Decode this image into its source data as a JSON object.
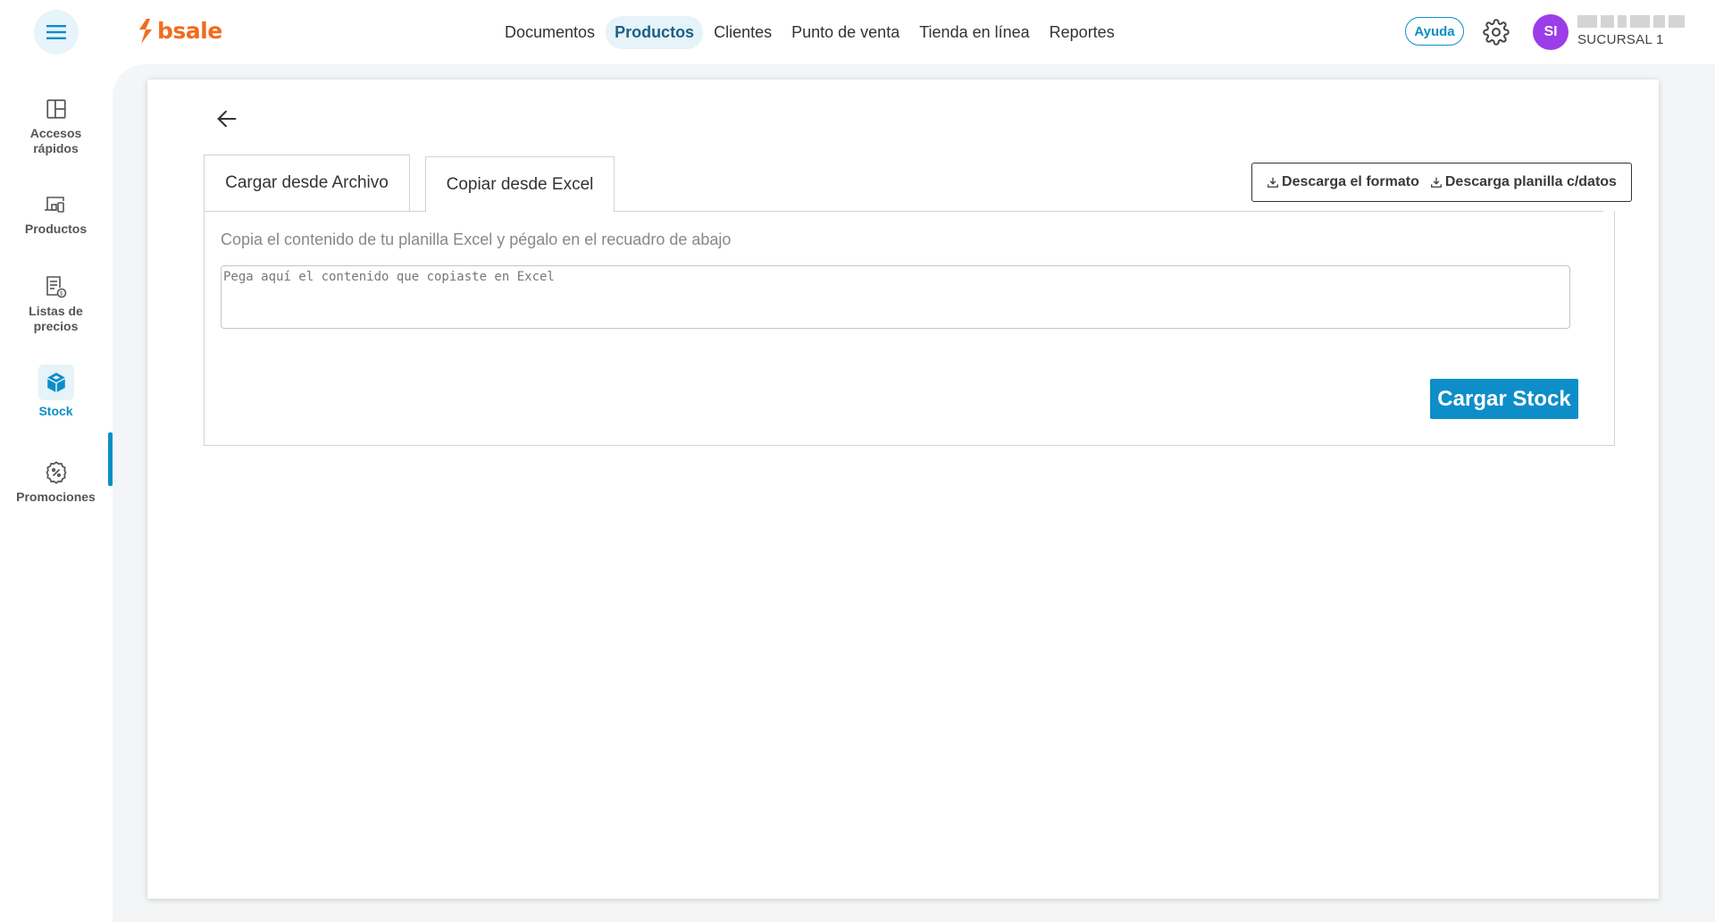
{
  "brand": {
    "logo_text": "bsale",
    "logo_color": "#f26b1d"
  },
  "topnav": {
    "items": [
      {
        "label": "Documentos"
      },
      {
        "label": "Productos",
        "active": true
      },
      {
        "label": "Clientes"
      },
      {
        "label": "Punto de venta"
      },
      {
        "label": "Tienda en línea"
      },
      {
        "label": "Reportes"
      }
    ]
  },
  "header": {
    "help_label": "Ayuda",
    "settings_icon": "gear-icon",
    "user_initials": "SI",
    "branch": "SUCURSAL 1"
  },
  "sidebar": {
    "items": [
      {
        "label": "Accesos rápidos",
        "icon": "layout-icon"
      },
      {
        "label": "Productos",
        "icon": "devices-icon"
      },
      {
        "label": "Listas de precios",
        "icon": "price-list-icon"
      },
      {
        "label": "Stock",
        "icon": "cube-icon",
        "active": true
      },
      {
        "label": "Promociones",
        "icon": "discount-badge-icon"
      }
    ]
  },
  "tabs": [
    {
      "label": "Cargar desde Archivo"
    },
    {
      "label": "Copiar desde Excel",
      "active": true
    }
  ],
  "downloads": {
    "format_label": "Descarga el formato",
    "data_label": "Descarga planilla c/datos"
  },
  "panel": {
    "instructions": "Copia el contenido de tu planilla Excel y pégalo en el recuadro de abajo",
    "paste_value": "",
    "paste_placeholder": "Pega aquí el contenido que copiaste en Excel",
    "submit_label": "Cargar Stock"
  },
  "colors": {
    "accent": "#0e8ec9",
    "active_nav_bg": "#e6f3f8",
    "avatar": "#9b3de8"
  }
}
